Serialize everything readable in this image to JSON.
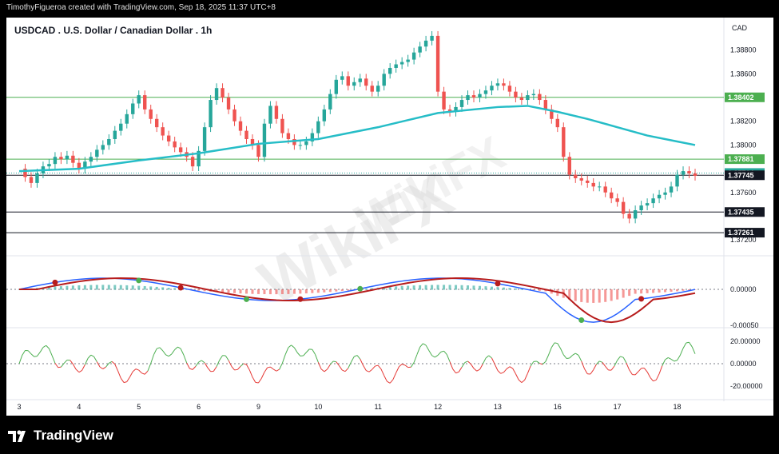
{
  "header": {
    "credit": "TimothyFigueroa created with TradingView.com, Sep 18, 2025 11:37 UTC+8"
  },
  "footer": {
    "brand": "TradingView"
  },
  "watermark": {
    "text": "WikiFX"
  },
  "chart_data": {
    "type": "line",
    "title": "USDCAD . U.S. Dollar / Canadian Dollar . 1h",
    "currency": "CAD",
    "price_panel": {
      "ylim": [
        1.3712,
        1.3898
      ],
      "y_ticks": [
        1.388,
        1.386,
        1.382,
        1.38,
        1.376,
        1.372
      ],
      "y_tick_labels": [
        "1.38800",
        "1.38600",
        "1.38200",
        "1.38000",
        "1.37600",
        "1.37200"
      ],
      "x_labels": [
        "3",
        "4",
        "5",
        "6",
        "9",
        "10",
        "11",
        "12",
        "13",
        "16",
        "17",
        "18"
      ],
      "x_positions": [
        0,
        10,
        20,
        30,
        40,
        50,
        60,
        70,
        80,
        90,
        100,
        110
      ],
      "close_path": [
        [
          0,
          1.378
        ],
        [
          1,
          1.3773
        ],
        [
          2,
          1.3768
        ],
        [
          3,
          1.3776
        ],
        [
          4,
          1.3782
        ],
        [
          5,
          1.3784
        ],
        [
          6,
          1.379
        ],
        [
          7,
          1.3788
        ],
        [
          8,
          1.3791
        ],
        [
          9,
          1.3785
        ],
        [
          10,
          1.378
        ],
        [
          11,
          1.3786
        ],
        [
          12,
          1.379
        ],
        [
          13,
          1.3796
        ],
        [
          14,
          1.38
        ],
        [
          15,
          1.3805
        ],
        [
          16,
          1.3812
        ],
        [
          17,
          1.3818
        ],
        [
          18,
          1.3826
        ],
        [
          19,
          1.3835
        ],
        [
          20,
          1.3842
        ],
        [
          21,
          1.383
        ],
        [
          22,
          1.3822
        ],
        [
          23,
          1.3815
        ],
        [
          24,
          1.3808
        ],
        [
          25,
          1.3803
        ],
        [
          26,
          1.3798
        ],
        [
          27,
          1.3794
        ],
        [
          28,
          1.379
        ],
        [
          29,
          1.3782
        ],
        [
          30,
          1.3795
        ],
        [
          31,
          1.3815
        ],
        [
          32,
          1.3838
        ],
        [
          33,
          1.3848
        ],
        [
          34,
          1.384
        ],
        [
          35,
          1.383
        ],
        [
          36,
          1.382
        ],
        [
          37,
          1.3812
        ],
        [
          38,
          1.3805
        ],
        [
          39,
          1.38
        ],
        [
          40,
          1.379
        ],
        [
          41,
          1.3818
        ],
        [
          42,
          1.3833
        ],
        [
          43,
          1.3822
        ],
        [
          44,
          1.381
        ],
        [
          45,
          1.3805
        ],
        [
          46,
          1.38
        ],
        [
          47,
          1.38
        ],
        [
          48,
          1.3803
        ],
        [
          49,
          1.381
        ],
        [
          50,
          1.382
        ],
        [
          51,
          1.383
        ],
        [
          52,
          1.3843
        ],
        [
          53,
          1.3855
        ],
        [
          54,
          1.3858
        ],
        [
          55,
          1.385
        ],
        [
          56,
          1.3853
        ],
        [
          57,
          1.3856
        ],
        [
          58,
          1.385
        ],
        [
          59,
          1.3845
        ],
        [
          60,
          1.385
        ],
        [
          61,
          1.386
        ],
        [
          62,
          1.3865
        ],
        [
          63,
          1.3868
        ],
        [
          64,
          1.387
        ],
        [
          65,
          1.3872
        ],
        [
          66,
          1.3878
        ],
        [
          67,
          1.3883
        ],
        [
          68,
          1.3888
        ],
        [
          69,
          1.3892
        ],
        [
          70,
          1.3845
        ],
        [
          71,
          1.383
        ],
        [
          72,
          1.3828
        ],
        [
          73,
          1.3832
        ],
        [
          74,
          1.3838
        ],
        [
          75,
          1.3842
        ],
        [
          76,
          1.384
        ],
        [
          77,
          1.3843
        ],
        [
          78,
          1.3846
        ],
        [
          79,
          1.385
        ],
        [
          80,
          1.3852
        ],
        [
          81,
          1.385
        ],
        [
          82,
          1.3845
        ],
        [
          83,
          1.384
        ],
        [
          84,
          1.3838
        ],
        [
          85,
          1.3842
        ],
        [
          86,
          1.3843
        ],
        [
          87,
          1.3838
        ],
        [
          88,
          1.383
        ],
        [
          89,
          1.3822
        ],
        [
          90,
          1.3815
        ],
        [
          91,
          1.379
        ],
        [
          92,
          1.3775
        ],
        [
          93,
          1.3772
        ],
        [
          94,
          1.377
        ],
        [
          95,
          1.3768
        ],
        [
          96,
          1.3765
        ],
        [
          97,
          1.3765
        ],
        [
          98,
          1.376
        ],
        [
          99,
          1.3755
        ],
        [
          100,
          1.3752
        ],
        [
          101,
          1.3742
        ],
        [
          102,
          1.3738
        ],
        [
          103,
          1.3745
        ],
        [
          104,
          1.3749
        ],
        [
          105,
          1.3751
        ],
        [
          106,
          1.3755
        ],
        [
          107,
          1.3758
        ],
        [
          108,
          1.376
        ],
        [
          109,
          1.3765
        ],
        [
          110,
          1.3775
        ],
        [
          111,
          1.3778
        ],
        [
          112,
          1.3776
        ],
        [
          113,
          1.3774
        ]
      ],
      "ma_path": [
        [
          0,
          1.3778
        ],
        [
          10,
          1.378
        ],
        [
          20,
          1.3787
        ],
        [
          30,
          1.3793
        ],
        [
          40,
          1.3801
        ],
        [
          50,
          1.3805
        ],
        [
          60,
          1.3815
        ],
        [
          70,
          1.3827
        ],
        [
          80,
          1.3832
        ],
        [
          85,
          1.3833
        ],
        [
          90,
          1.3828
        ],
        [
          95,
          1.3822
        ],
        [
          100,
          1.3815
        ],
        [
          105,
          1.3808
        ],
        [
          110,
          1.3803
        ],
        [
          113,
          1.38
        ]
      ],
      "horizontal_levels": [
        {
          "price": 1.38402,
          "label": "1.38402",
          "color": "#4caf50",
          "style": "line"
        },
        {
          "price": 1.37881,
          "label": "1.37881",
          "color": "#4caf50",
          "style": "line"
        },
        {
          "price": 1.37764,
          "label": "1.37764",
          "color": "#26a69a",
          "style": "dotted"
        },
        {
          "price": 1.37745,
          "label": "1.37745",
          "color": "#131722",
          "style": "line"
        },
        {
          "price": 1.37435,
          "label": "1.37435",
          "color": "#131722",
          "style": "line"
        },
        {
          "price": 1.37261,
          "label": "1.37261",
          "color": "#131722",
          "style": "line"
        }
      ]
    },
    "macd_panel": {
      "y_tick_labels": [
        "0.00000",
        "-0.00050"
      ],
      "macd_color": "#2962ff",
      "signal_color": "#4caf50",
      "signal_down_color": "#b71c1c"
    },
    "oscillator_panel": {
      "y_tick_labels": [
        "20.00000",
        "0.00000",
        "-20.00000"
      ],
      "up_color": "#4caf50",
      "down_color": "#e53935"
    },
    "colors": {
      "up": "#26a69a",
      "down": "#ef5350",
      "ma": "#26bdc7",
      "accent_level": "#4caf50"
    }
  }
}
